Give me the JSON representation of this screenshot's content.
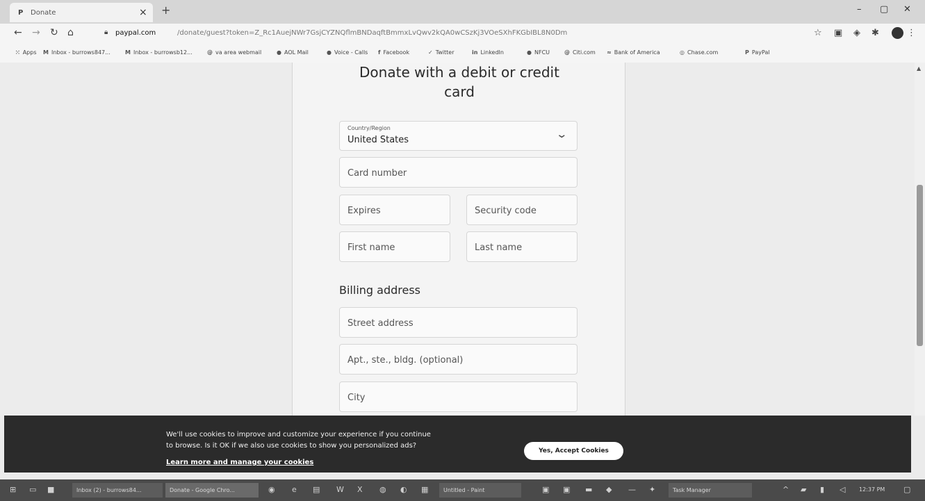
{
  "browser": {
    "tab_title": "Donate",
    "tab_favicon": "paypal-icon",
    "url_host": "paypal.com",
    "url_rest": "/donate/guest?token=Z_Rc1AuejNWr7GsjCYZNQflmBNDaqftBmmxLvQwv2kQA0wCSzKj3VOeSXhFKGbIBL8N0Dm",
    "bookmarks": [
      {
        "label": "Apps",
        "icon": "apps-grid-icon"
      },
      {
        "label": "Inbox - burrows847...",
        "icon": "gmail-icon"
      },
      {
        "label": "Inbox - burrowsb12...",
        "icon": "gmail-icon"
      },
      {
        "label": "va area webmail",
        "icon": "webmail-icon"
      },
      {
        "label": "AOL Mail",
        "icon": "aol-icon"
      },
      {
        "label": "Voice - Calls",
        "icon": "voice-icon"
      },
      {
        "label": "Facebook",
        "icon": "facebook-icon"
      },
      {
        "label": "Twitter",
        "icon": "twitter-icon"
      },
      {
        "label": "LinkedIn",
        "icon": "linkedin-icon"
      },
      {
        "label": "NFCU",
        "icon": "nfcu-icon"
      },
      {
        "label": "Citi.com",
        "icon": "citi-icon"
      },
      {
        "label": "Bank of America",
        "icon": "boa-icon"
      },
      {
        "label": "Chase.com",
        "icon": "chase-icon"
      },
      {
        "label": "PayPal",
        "icon": "paypal-icon"
      }
    ]
  },
  "form": {
    "heading_line1": "Donate with a debit or credit",
    "heading_line2": "card",
    "country_label": "Country/Region",
    "country_value": "United States",
    "card_number": "Card number",
    "expires": "Expires",
    "security_code": "Security code",
    "first_name": "First name",
    "last_name": "Last name",
    "billing_heading": "Billing address",
    "street": "Street address",
    "apt": "Apt., ste., bldg. (optional)",
    "city": "City"
  },
  "cookie": {
    "line1": "We'll use cookies to improve and customize your experience if you continue",
    "line2": "to browse. Is it OK if we also use cookies to show you personalized ads?",
    "learn_more": "Learn more and manage your cookies",
    "accept": "Yes, Accept Cookies"
  },
  "taskbar": {
    "inbox_btn": "Inbox (2) - burrows84...",
    "donate_btn": "Donate - Google Chro...",
    "paint_btn": "Untitled - Paint",
    "taskmgr_btn": "Task Manager",
    "clock": "12:37 PM"
  },
  "colors": {
    "banner_bg": "#2b2b2b",
    "accept_bg": "#ffffff"
  }
}
